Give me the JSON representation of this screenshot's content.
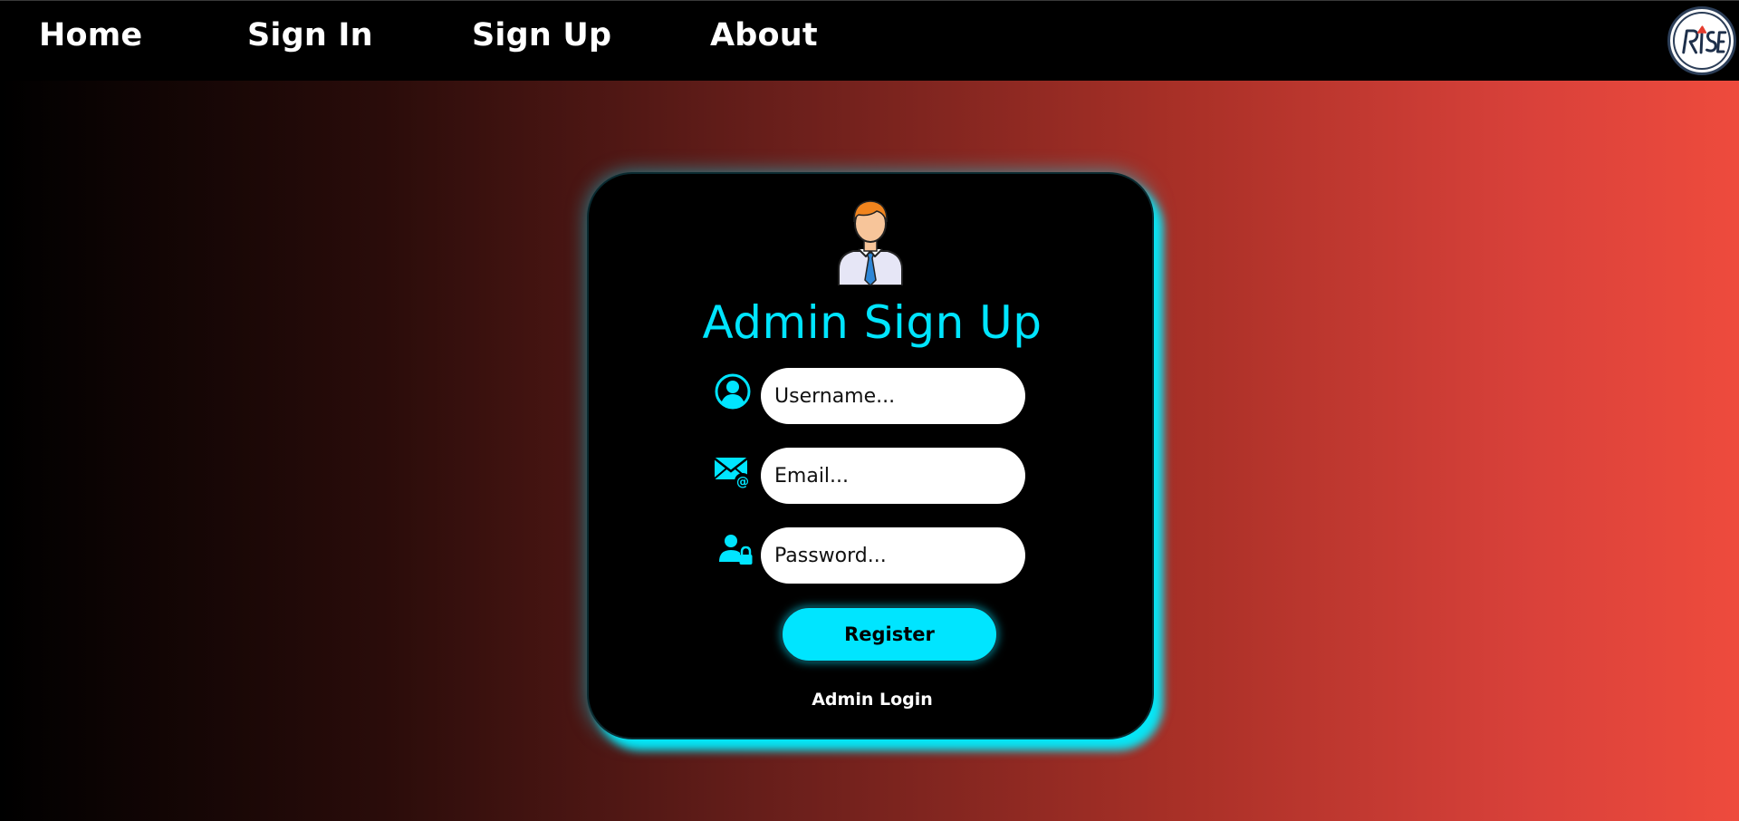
{
  "nav": {
    "items": [
      {
        "label": "Home"
      },
      {
        "label": "Sign In"
      },
      {
        "label": "Sign Up"
      },
      {
        "label": "About"
      }
    ],
    "logo_text": "RISE"
  },
  "colors": {
    "accent": "#00e5ff",
    "nav_background": "#000000",
    "card_background": "#000000",
    "gradient_start": "#000000",
    "gradient_end": "#ee4b3d"
  },
  "form": {
    "title": "Admin Sign Up",
    "username_placeholder": "Username...",
    "email_placeholder": "Email...",
    "password_placeholder": "Password...",
    "register_label": "Register",
    "admin_login_link": "Admin Login"
  },
  "icons": {
    "avatar": "admin-avatar-icon",
    "username": "user-circle-icon",
    "email": "mail-at-icon",
    "password": "user-lock-icon"
  }
}
